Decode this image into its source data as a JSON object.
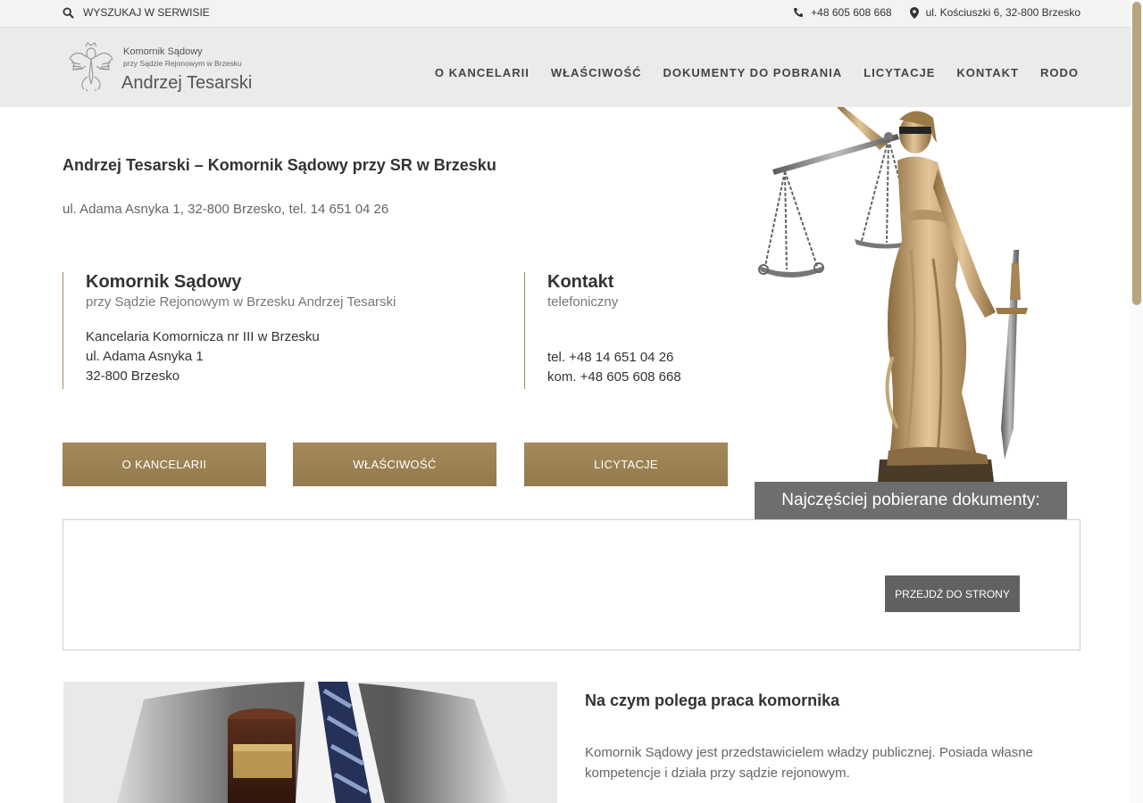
{
  "topbar": {
    "search_label": "WYSZUKAJ W SERWISIE",
    "phone": "+48 605 608 668",
    "address": "ul. Kościuszki 6, 32-800 Brzesko"
  },
  "logo": {
    "line1": "Komornik Sądowy",
    "line2": "przy Sądzie Rejonowym w Brzesku",
    "name": "Andrzej Tesarski"
  },
  "nav": {
    "items": [
      {
        "label": "O KANCELARII"
      },
      {
        "label": "WŁAŚCIWOŚĆ"
      },
      {
        "label": "DOKUMENTY DO POBRANIA"
      },
      {
        "label": "LICYTACJE"
      },
      {
        "label": "KONTAKT"
      },
      {
        "label": "RODO"
      }
    ]
  },
  "main": {
    "title": "Andrzej Tesarski – Komornik Sądowy przy SR w Brzesku",
    "address_line": "ul. Adama Asnyka 1, 32-800 Brzesko, tel. 14 651 04 26",
    "col1": {
      "heading": "Komornik Sądowy",
      "subheading": "przy Sądzie Rejonowym w Brzesku Andrzej Tesarski",
      "lines": [
        "Kancelaria Komornicza nr III w Brzesku",
        "ul. Adama Asnyka 1",
        "32-800 Brzesko"
      ]
    },
    "col2": {
      "heading": "Kontakt",
      "subheading": "telefoniczny",
      "lines": [
        "tel. +48 14 651 04 26",
        "kom. +48 605 608 668"
      ]
    },
    "buttons": [
      {
        "label": "O KANCELARII"
      },
      {
        "label": "WŁAŚCIWOŚĆ"
      },
      {
        "label": "LICYTACJE"
      }
    ]
  },
  "docs": {
    "tab_label": "Najczęściej pobierane dokumenty:",
    "button_label": "PRZEJDŹ DO STRONY"
  },
  "bottom": {
    "title": "Na czym polega praca komornika",
    "text": "Komornik Sądowy jest przedstawicielem władzy publicznej. Posiada własne kompetencje i działa przy sądzie rejonowym."
  },
  "colors": {
    "accent_gold": "#a4895a",
    "docs_tab": "#6e6e6e",
    "button_grey": "#616161",
    "header_bg": "#ebebeb"
  }
}
